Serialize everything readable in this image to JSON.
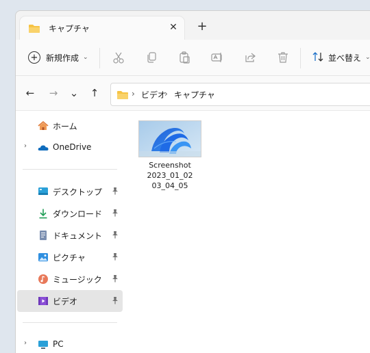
{
  "tab": {
    "title": "キャプチャ",
    "close_glyph": "✕",
    "new_tab_glyph": "+"
  },
  "toolbar": {
    "new_label": "新規作成",
    "new_chevron": "⌄",
    "sort_label": "並べ替え",
    "sort_chevron": "⌄",
    "icons": [
      "cut-icon",
      "copy-icon",
      "paste-icon",
      "rename-icon",
      "share-icon",
      "delete-icon"
    ]
  },
  "nav": {
    "back": "←",
    "forward": "→",
    "recent": "⌄",
    "up": "↑"
  },
  "breadcrumb": {
    "sep": "›",
    "items": [
      "ビデオ",
      "キャプチャ"
    ]
  },
  "sidebar": {
    "items": [
      {
        "label": "ホーム",
        "icon": "home-icon"
      },
      {
        "label": "OneDrive",
        "icon": "onedrive-icon"
      },
      {
        "label": "デスクトップ",
        "icon": "desktop-icon"
      },
      {
        "label": "ダウンロード",
        "icon": "download-icon"
      },
      {
        "label": "ドキュメント",
        "icon": "document-icon"
      },
      {
        "label": "ピクチャ",
        "icon": "pictures-icon"
      },
      {
        "label": "ミュージック",
        "icon": "music-icon"
      },
      {
        "label": "ビデオ",
        "icon": "video-icon"
      },
      {
        "label": "PC",
        "icon": "pc-icon"
      }
    ],
    "pin_glyph": "📌",
    "expand_glyph": "›"
  },
  "files": [
    {
      "name_line1": "Screenshot",
      "name_line2": "2023_01_02",
      "name_line3": "03_04_05"
    }
  ],
  "colors": {
    "accent": "#0067c0",
    "folder": "#f6c344",
    "selected": "#e5e5e5"
  }
}
